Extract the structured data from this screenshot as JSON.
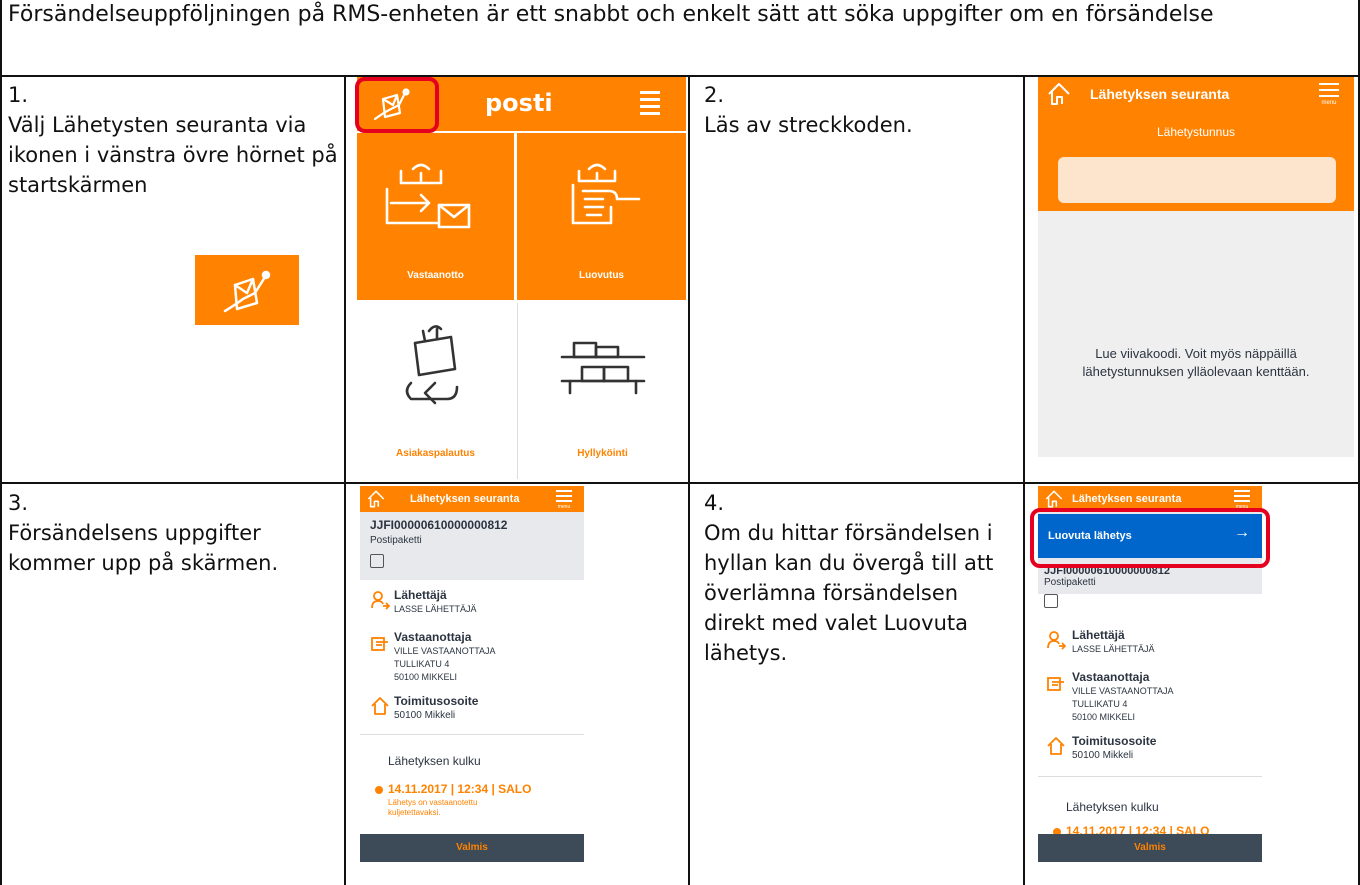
{
  "header": {
    "text": "Försändelseuppföljningen på RMS-enheten är ett snabbt och enkelt sätt att söka uppgifter om en försändelse"
  },
  "steps": [
    {
      "num": "1.",
      "text": "Välj Lähetysten seuranta via ikonen i vänstra övre hörnet på startskärmen"
    },
    {
      "num": "2.",
      "text": "Läs av streckkoden."
    },
    {
      "num": "3.",
      "text": "Försändelsens uppgifter kommer upp på skärmen."
    },
    {
      "num": "4.",
      "text": "Om du hittar försändelsen i hyllan kan du övergå till att överlämna försändelsen direkt med valet Luovuta lähetys."
    }
  ],
  "phone1": {
    "logo": "posti",
    "tiles": [
      "Vastaanotto",
      "Luovutus",
      "Asiakaspalautus",
      "Hyllyköinti"
    ]
  },
  "phone2": {
    "title": "Lähetyksen seuranta",
    "menu": "menu",
    "field_label": "Lähetystunnus",
    "field_value": "",
    "instruction": "Lue viivakoodi. Voit myös näppäillä lähetystunnuksen ylläolevaan kenttään."
  },
  "phone3": {
    "title": "Lähetyksen seuranta",
    "menu": "menu",
    "tracking_id": "JJFI00000610000000812",
    "product": "Postipaketti",
    "sender_label": "Lähettäjä",
    "sender_name": "LASSE LÄHETTÄJÄ",
    "recipient_label": "Vastaanottaja",
    "recipient_lines": [
      "VILLE VASTAANOTTAJA",
      "TULLIKATU 4",
      "50100 MIKKELI"
    ],
    "delivery_label": "Toimitusosoite",
    "delivery_value": "50100 Mikkeli",
    "history_title": "Lähetyksen kulku",
    "event_time": "14.11.2017 | 12:34 | SALO",
    "event_desc": "Lähetys on vastaanotettu kuljetettavaksi.",
    "done_button": "Valmis"
  },
  "phone4": {
    "title": "Lähetyksen seuranta",
    "menu": "menu",
    "action_button": "Luovuta lähetys",
    "action_arrow": "→",
    "tracking_id": "JJFI00000610000000812",
    "product": "Postipaketti",
    "sender_label": "Lähettäjä",
    "sender_name": "LASSE LÄHETTÄJÄ",
    "recipient_label": "Vastaanottaja",
    "recipient_lines": [
      "VILLE VASTAANOTTAJA",
      "TULLIKATU 4",
      "50100 MIKKELI"
    ],
    "delivery_label": "Toimitusosoite",
    "delivery_value": "50100 Mikkeli",
    "history_title": "Lähetyksen kulku",
    "event_time": "14.11.2017 | 12:34 | SALO",
    "done_button": "Valmis"
  },
  "colors": {
    "orange": "#ff8200",
    "dark": "#3d4a57",
    "blue": "#0066cc",
    "highlight": "#e6001f",
    "gray": "#e7e9ec"
  }
}
